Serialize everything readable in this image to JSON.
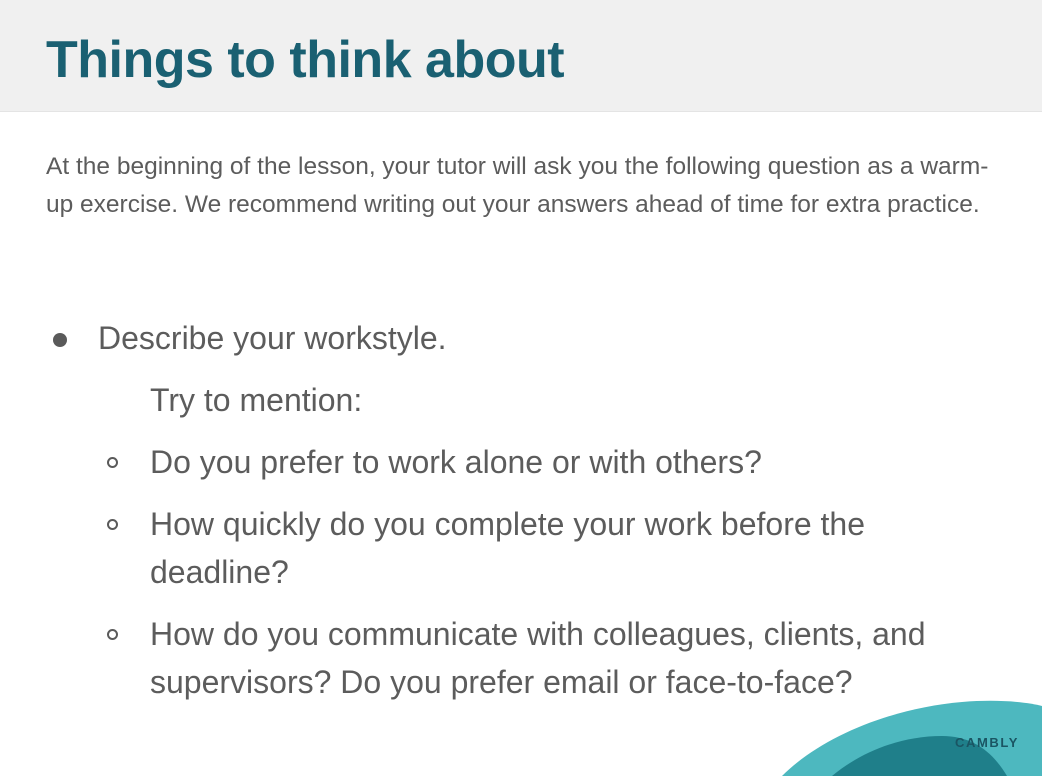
{
  "header": {
    "title": "Things to think about"
  },
  "intro": "At the beginning of the lesson, your tutor will ask you the following question as a warm-up exercise. We recommend writing out your answers ahead of time for extra practice.",
  "question": {
    "text": "Describe your workstyle.",
    "hint": "Try to mention:",
    "sub_items": [
      "Do you prefer to work alone or with others?",
      "How quickly do you complete your work before the deadline?",
      "How do you communicate with colleagues, clients, and supervisors? Do you prefer email or face-to-face?"
    ]
  },
  "logo": {
    "text": "CAMBLY"
  },
  "colors": {
    "title": "#1a6072",
    "body_text": "#5c5c5c",
    "header_bg": "#f0f0f0",
    "logo_teal_light": "#4db8bf",
    "logo_teal_dark": "#1f7f8a"
  }
}
